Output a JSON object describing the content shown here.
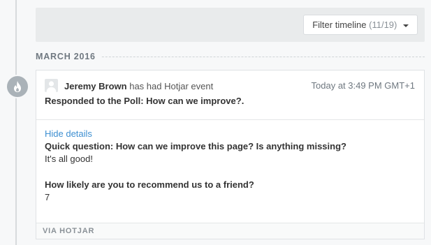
{
  "filter": {
    "label": "Filter timeline",
    "count": "(11/19)"
  },
  "month": "MARCH 2016",
  "event": {
    "user": "Jeremy Brown",
    "action": "has had Hotjar event",
    "timestamp": "Today at 3:49 PM GMT+1",
    "title": "Responded to the Poll: How can we improve?.",
    "toggle_label": "Hide details",
    "qa": [
      {
        "question": "Quick question: How can we improve this page? Is anything missing?",
        "answer": "It's all good!"
      },
      {
        "question": "How likely are you to recommend us to a friend?",
        "answer": "7"
      }
    ],
    "source": "VIA HOTJAR"
  },
  "icons": {
    "event": "flame-icon",
    "dropdown": "caret-down-icon",
    "avatar": "user-avatar-icon"
  },
  "colors": {
    "link": "#3d8fd1",
    "dot": "#aab2b8"
  }
}
